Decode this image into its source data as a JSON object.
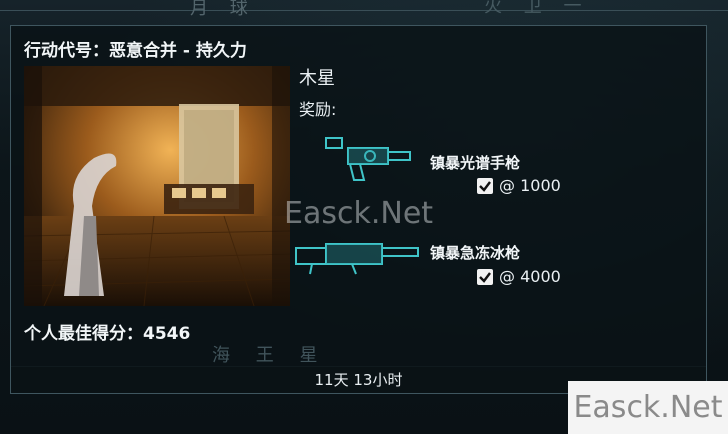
{
  "background_labels": {
    "top_left": "月 球",
    "top_right": "火 卫 一",
    "bottom": "海 王 星"
  },
  "mission": {
    "title": "行动代号：恶意合并 - 持久力",
    "planet": "木星",
    "rewards_label": "奖励:",
    "rewards": [
      {
        "name": "镇暴光谱手枪",
        "checked": true,
        "threshold": "@ 1000",
        "icon": "spectra-pistol-icon"
      },
      {
        "name": "镇暴急冻冰枪",
        "checked": true,
        "threshold": "@ 4000",
        "icon": "glaxion-rifle-icon"
      }
    ],
    "personal_best": "个人最佳得分：4546",
    "time_remaining": "11天 13小时"
  },
  "watermark": {
    "center": "Easck.Net",
    "corner": "Easck.Net"
  },
  "colors": {
    "panel_border": "#3f565f",
    "weapon_accent": "#3fc4c8",
    "text": "#e8eef1"
  }
}
